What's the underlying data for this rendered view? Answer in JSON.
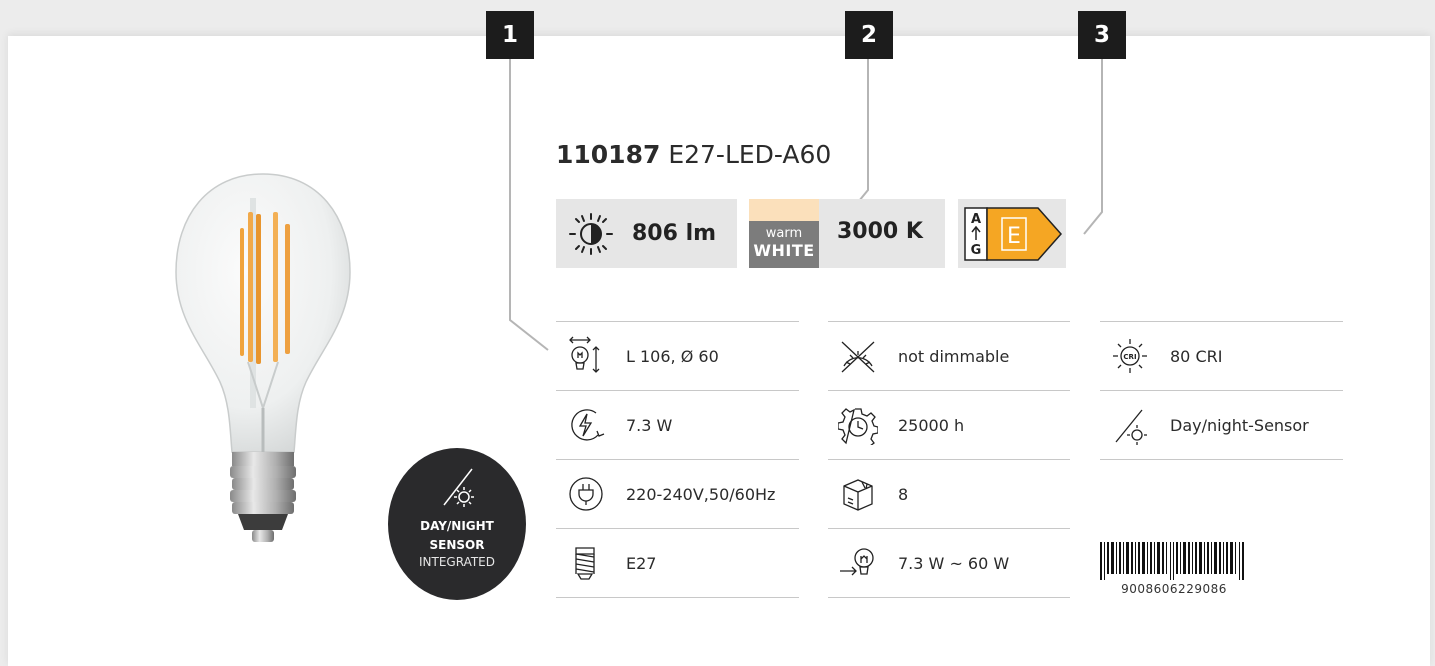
{
  "badges": [
    "1",
    "2",
    "3"
  ],
  "product": {
    "code": "110187",
    "name": "E27-LED-A60"
  },
  "highlights": {
    "lumen": "806 lm",
    "color_label_top": "warm",
    "color_label_bottom": "WHITE",
    "color_temperature": "3000 K",
    "energy_scale_top": "A",
    "energy_scale_bottom": "G",
    "energy_class": "E",
    "energy_class_color": "#f5a623"
  },
  "sensor_badge": {
    "line1": "DAY/NIGHT",
    "line2": "SENSOR",
    "line3": "INTEGRATED"
  },
  "specs": {
    "col1": [
      {
        "icon": "dimensions-icon",
        "text": "L 106, Ø 60"
      },
      {
        "icon": "power-icon",
        "text": "7.3 W"
      },
      {
        "icon": "voltage-plug-icon",
        "text": "220-240V,50/60Hz"
      },
      {
        "icon": "socket-e27-icon",
        "text": "E27"
      }
    ],
    "col2": [
      {
        "icon": "not-dimmable-icon",
        "text": "not dimmable"
      },
      {
        "icon": "lifetime-hours-icon",
        "text": "25000 h"
      },
      {
        "icon": "package-box-icon",
        "text": "8"
      },
      {
        "icon": "equivalent-wattage-icon",
        "text": "7.3 W ~ 60 W"
      }
    ],
    "col3": [
      {
        "icon": "cri-icon",
        "text": "80 CRI"
      },
      {
        "icon": "day-night-sensor-icon",
        "text": "Day/night-Sensor"
      }
    ]
  },
  "barcode": "9008606229086",
  "colors": {
    "badge_bg": "#1c1c1c",
    "box_bg": "#e6e6e6",
    "warm_tint": "#fbe0bb",
    "energy_orange": "#f5a623"
  }
}
